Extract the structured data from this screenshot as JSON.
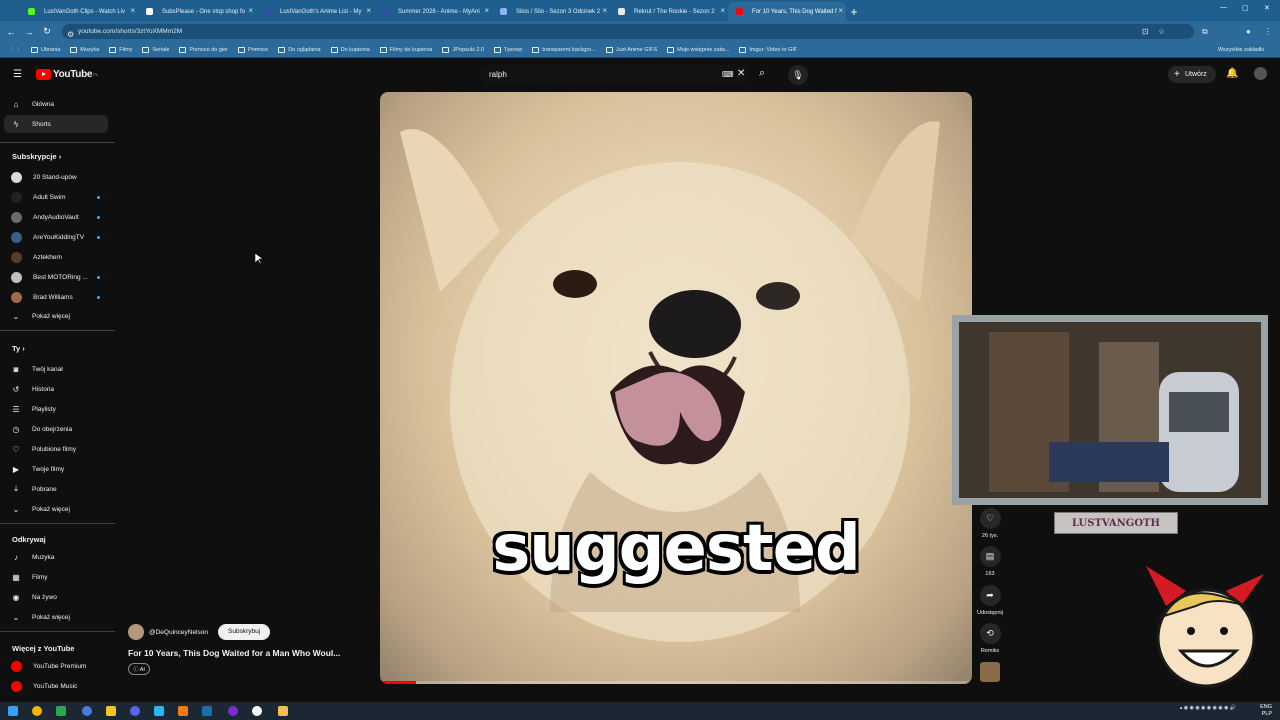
{
  "browser": {
    "tabs": [
      {
        "label": "LustVanGoth Clips - Watch Liv",
        "color": "#53fc18"
      },
      {
        "label": "SubsPlease - One stop shop fo",
        "color": "#ffffff"
      },
      {
        "label": "LustVanGoth's Anime List - My",
        "color": "#2e51a2"
      },
      {
        "label": "Summer 2026 - Anime - MyAni",
        "color": "#2e51a2"
      },
      {
        "label": "Silos / Silo - Sezon 3 Odcinek 2",
        "color": "#8ab4f8"
      },
      {
        "label": "Rekrut / The Rookie - Sezon 2",
        "color": "#e8eaed"
      },
      {
        "label": "For 10 Years, This Dog Waited f",
        "color": "#ff0000"
      }
    ],
    "url": "youtube.com/shorts/3ztYoXMMm2M",
    "bookmarks": [
      "Ubrania",
      "Muzyka",
      "Filmy",
      "Seriale",
      "Pomoce do gier",
      "Pomoce",
      "Do oglądania",
      "Do kupienia",
      "Filmy do kupienia",
      "JPopsuki 2.0",
      "Tpexep",
      "transparent backgro...",
      "Just Anime GIFS",
      "Moje wstępnie zatw...",
      "Imgur: Video to GIF"
    ],
    "bookmarks_right": "Wszystkie zakładki"
  },
  "header": {
    "logo_text": "YouTube",
    "logo_region": "PL",
    "search_value": "ralph",
    "create_label": "Utwórz"
  },
  "sidebar": {
    "top": [
      {
        "label": "Główna",
        "icon": "home-icon"
      },
      {
        "label": "Shorts",
        "icon": "shorts-icon"
      }
    ],
    "subs_header": "Subskrypcje",
    "subs": [
      {
        "label": "20 Stand-upów",
        "color": "#d9d9d9",
        "live": false
      },
      {
        "label": "Adult Swim",
        "color": "#222222",
        "live": true
      },
      {
        "label": "AndyAudioVault",
        "color": "#6b6b6b",
        "live": true
      },
      {
        "label": "AreYouKiddingTV",
        "color": "#3a5f8a",
        "live": true
      },
      {
        "label": "Aztekhem",
        "color": "#5b3a2a",
        "live": false
      },
      {
        "label": "Best MOTORing ...",
        "color": "#c0c0c0",
        "live": true
      },
      {
        "label": "Brad Williams",
        "color": "#a26a4a",
        "live": true
      }
    ],
    "show_more": "Pokaż więcej",
    "you_header": "Ty",
    "you": [
      {
        "label": "Twój kanał",
        "icon": "channel-icon"
      },
      {
        "label": "Historia",
        "icon": "history-icon"
      },
      {
        "label": "Playlisty",
        "icon": "playlist-icon"
      },
      {
        "label": "Do obejrzenia",
        "icon": "clock-icon"
      },
      {
        "label": "Polubione filmy",
        "icon": "like-icon"
      },
      {
        "label": "Twoje filmy",
        "icon": "video-icon"
      },
      {
        "label": "Pobrane",
        "icon": "download-icon"
      }
    ],
    "explore_header": "Odkrywaj",
    "explore": [
      {
        "label": "Muzyka",
        "icon": "music-icon"
      },
      {
        "label": "Filmy",
        "icon": "film-icon"
      },
      {
        "label": "Na żywo",
        "icon": "live-icon"
      }
    ],
    "more_header": "Więcej z YouTube",
    "more": [
      {
        "label": "YouTube Premium",
        "color": "#ff0000"
      },
      {
        "label": "YouTube Music",
        "color": "#ff0000"
      }
    ]
  },
  "short": {
    "caption": "suggested",
    "channel": "@DeQuinceyNelson",
    "subscribe": "Subskrybuj",
    "title": "For 10 Years, This Dog Waited for a Man Who Woul...",
    "ai_badge": "AI",
    "progress": 0.06,
    "actions": [
      {
        "icon": "like-icon",
        "label": "26 tys."
      },
      {
        "icon": "comment-icon",
        "label": "163"
      },
      {
        "icon": "share-icon",
        "label": "Udostępnij"
      },
      {
        "icon": "remix-icon",
        "label": "Remiks"
      }
    ]
  },
  "overlay": {
    "streamer_name": "LUSTVANGOTH"
  },
  "taskbar": {
    "lang": "ENG",
    "layout": "PLP"
  }
}
